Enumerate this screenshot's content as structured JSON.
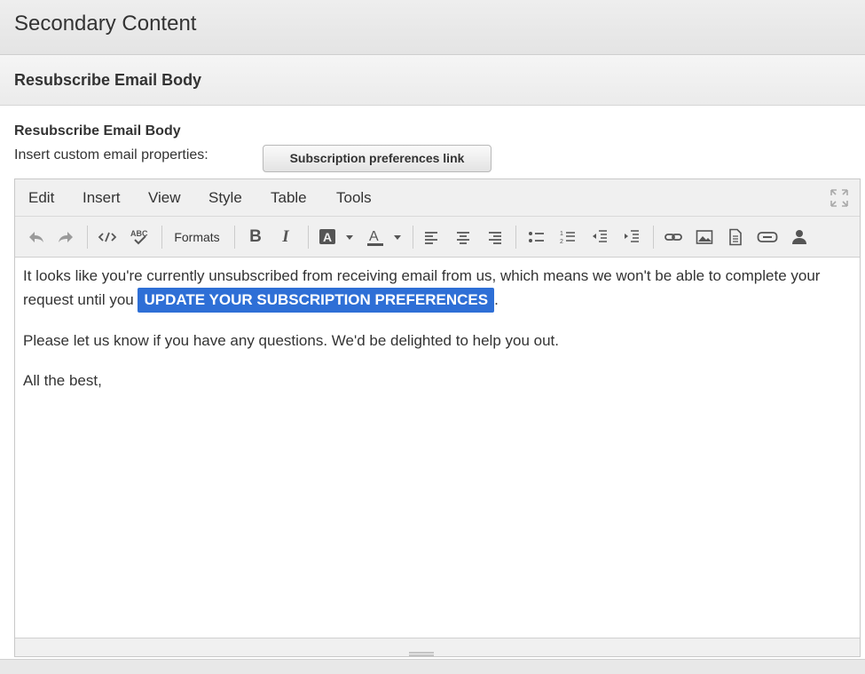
{
  "section_title": "Secondary Content",
  "subsection_title": "Resubscribe Email Body",
  "field": {
    "title": "Resubscribe Email Body",
    "props_label": "Insert custom email properties:",
    "props_button": "Subscription preferences link"
  },
  "editor": {
    "menu": [
      "Edit",
      "Insert",
      "View",
      "Style",
      "Table",
      "Tools"
    ],
    "toolbar": {
      "formats_label": "Formats",
      "bold_label": "B",
      "italic_label": "I",
      "icons": [
        "undo-icon",
        "redo-icon",
        "source-code-icon",
        "spellcheck-icon",
        "background-color-icon",
        "text-color-icon",
        "align-left-icon",
        "align-center-icon",
        "align-right-icon",
        "bullet-list-icon",
        "numbered-list-icon",
        "outdent-icon",
        "indent-icon",
        "link-icon",
        "image-icon",
        "template-icon",
        "button-icon",
        "person-icon",
        "fullscreen-icon"
      ]
    },
    "body": {
      "p1_text": "It looks like you're currently unsubscribed from receiving email from us, which means we won't be able to complete your request until you ",
      "p1_button": "UPDATE YOUR SUBSCRIPTION PREFERENCES",
      "p1_end": ".",
      "p2": "Please let us know if you have any questions. We'd be delighted to help you out.",
      "p3": "All the best,"
    },
    "link_color": "#2e6fd6"
  }
}
